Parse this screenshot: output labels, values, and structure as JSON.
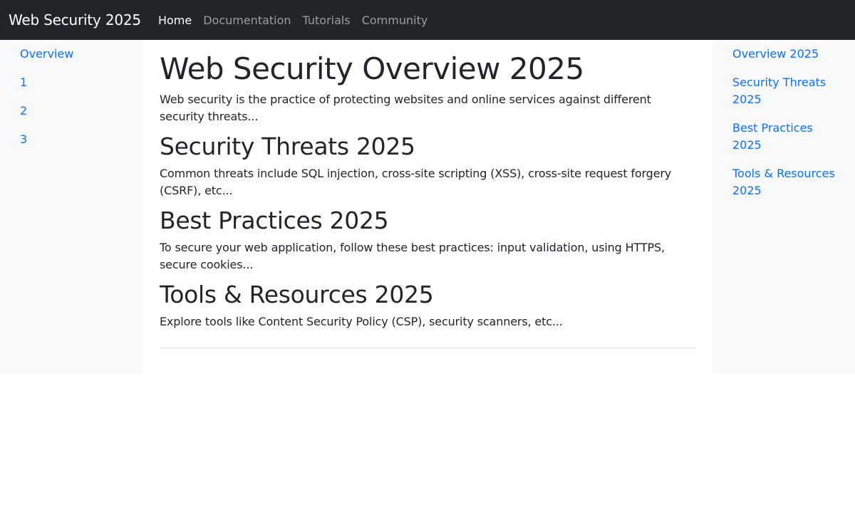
{
  "navbar": {
    "brand": "Web Security 2025",
    "links": [
      {
        "label": "Home",
        "active": true
      },
      {
        "label": "Documentation",
        "active": false
      },
      {
        "label": "Tutorials",
        "active": false
      },
      {
        "label": "Community",
        "active": false
      }
    ]
  },
  "left_sidebar": {
    "items": [
      "Overview",
      "1",
      "2",
      "3"
    ]
  },
  "main": {
    "title": "Web Security Overview 2025",
    "intro": "Web security is the practice of protecting websites and online services against different security threats...",
    "sections": [
      {
        "heading": "Security Threats 2025",
        "text": "Common threats include SQL injection, cross-site scripting (XSS), cross-site request forgery (CSRF), etc..."
      },
      {
        "heading": "Best Practices 2025",
        "text": "To secure your web application, follow these best practices: input validation, using HTTPS, secure cookies..."
      },
      {
        "heading": "Tools & Resources 2025",
        "text": "Explore tools like Content Security Policy (CSP), security scanners, etc..."
      }
    ]
  },
  "right_sidebar": {
    "items": [
      "Overview 2025",
      "Security Threats 2025",
      "Best Practices 2025",
      "Tools & Resources 2025"
    ]
  },
  "colors": {
    "navbar_bg": "#212529",
    "link": "#0d6efd",
    "sidebar_bg": "#f8f9fa"
  }
}
